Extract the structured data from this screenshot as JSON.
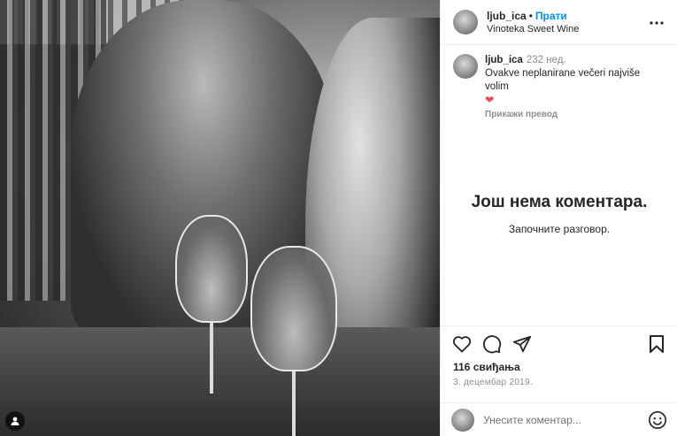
{
  "post": {
    "username": "ljub_ica",
    "separator": "•",
    "follow_label": "Прати",
    "location": "Vinoteka Sweet Wine",
    "caption": {
      "username": "ljub_ica",
      "time": "232 нед.",
      "text": "Ovakve neplanirane večeri najviše volim",
      "emoji": "❤",
      "translate_label": "Прикажи превод"
    },
    "empty_comments": {
      "title": "Још нема коментара.",
      "subtitle": "Започните разговор."
    },
    "likes": "116 свиђања",
    "date": "3. децембар 2019.",
    "comment_placeholder": "Унесите коментар..."
  },
  "icons": {
    "more": "more-options-icon",
    "like": "heart-icon",
    "comment": "comment-icon",
    "share": "share-icon",
    "save": "bookmark-icon",
    "emoji": "emoji-icon",
    "tagged_user": "user-tag-icon"
  },
  "colors": {
    "link": "#0095f6",
    "heart": "#ed4956",
    "muted": "#8e8e8e"
  }
}
